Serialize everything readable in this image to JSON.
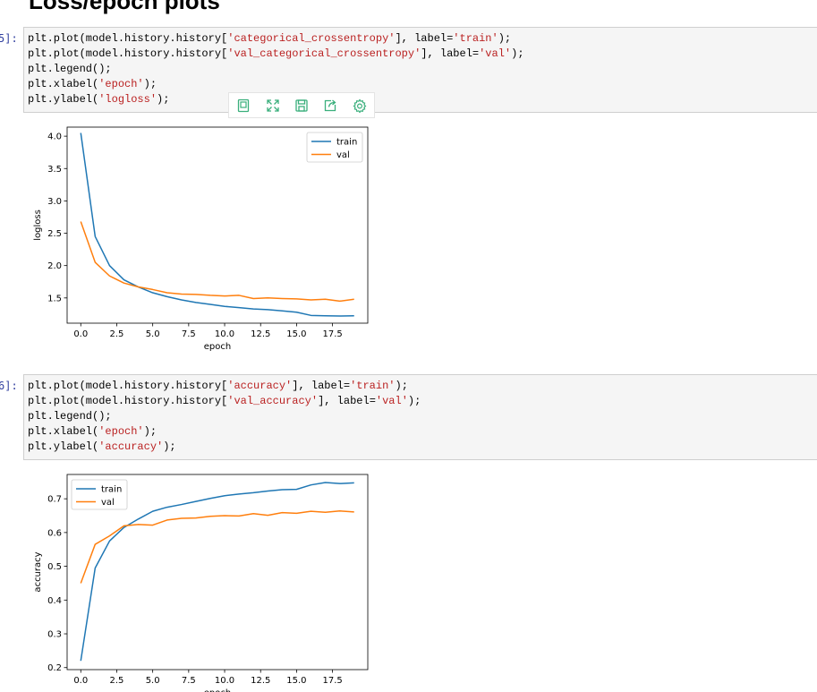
{
  "heading": "Loss/epoch plots",
  "cells": [
    {
      "prompt": "5]:",
      "lines": [
        [
          {
            "t": "plt.plot(model.history.history["
          },
          {
            "t": "'categorical_crossentropy'",
            "s": 1
          },
          {
            "t": "], label="
          },
          {
            "t": "'train'",
            "s": 1
          },
          {
            "t": ");"
          }
        ],
        [
          {
            "t": "plt.plot(model.history.history["
          },
          {
            "t": "'val_categorical_crossentropy'",
            "s": 1
          },
          {
            "t": "], label="
          },
          {
            "t": "'val'",
            "s": 1
          },
          {
            "t": ");"
          }
        ],
        [
          {
            "t": "plt.legend();"
          }
        ],
        [
          {
            "t": "plt.xlabel("
          },
          {
            "t": "'epoch'",
            "s": 1
          },
          {
            "t": ");"
          }
        ],
        [
          {
            "t": "plt.ylabel("
          },
          {
            "t": "'logloss'",
            "s": 1
          },
          {
            "t": ");"
          }
        ]
      ]
    },
    {
      "prompt": "6]:",
      "lines": [
        [
          {
            "t": "plt.plot(model.history.history["
          },
          {
            "t": "'accuracy'",
            "s": 1
          },
          {
            "t": "], label="
          },
          {
            "t": "'train'",
            "s": 1
          },
          {
            "t": ");"
          }
        ],
        [
          {
            "t": "plt.plot(model.history.history["
          },
          {
            "t": "'val_accuracy'",
            "s": 1
          },
          {
            "t": "], label="
          },
          {
            "t": "'val'",
            "s": 1
          },
          {
            "t": ");"
          }
        ],
        [
          {
            "t": "plt.legend();"
          }
        ],
        [
          {
            "t": "plt.xlabel("
          },
          {
            "t": "'epoch'",
            "s": 1
          },
          {
            "t": ");"
          }
        ],
        [
          {
            "t": "plt.ylabel("
          },
          {
            "t": "'accuracy'",
            "s": 1
          },
          {
            "t": ");"
          }
        ]
      ]
    }
  ],
  "toolbar": {
    "accent": "#3aaf7c",
    "icons": [
      "copy-icon",
      "expand-icon",
      "save-icon",
      "share-icon",
      "gear-icon"
    ]
  },
  "colors": {
    "train": "#1f77b4",
    "val": "#ff7f0e"
  },
  "chart_data": [
    {
      "type": "line",
      "title": "",
      "xlabel": "epoch",
      "ylabel": "logloss",
      "xlim": [
        -0.95,
        19.95
      ],
      "ylim": [
        1.11,
        4.14
      ],
      "xticks": [
        0,
        2.5,
        5,
        7.5,
        10,
        12.5,
        15,
        17.5
      ],
      "xtick_labels": [
        "0.0",
        "2.5",
        "5.0",
        "7.5",
        "10.0",
        "12.5",
        "15.0",
        "17.5"
      ],
      "yticks": [
        1.5,
        2,
        2.5,
        3,
        3.5,
        4
      ],
      "ytick_labels": [
        "1.5",
        "2.0",
        "2.5",
        "3.0",
        "3.5",
        "4.0"
      ],
      "legend": "top-right",
      "grid": false,
      "x": [
        0,
        1,
        2,
        3,
        4,
        5,
        6,
        7,
        8,
        9,
        10,
        11,
        12,
        13,
        14,
        15,
        16,
        17,
        18,
        19
      ],
      "series": [
        {
          "name": "train",
          "color": "#1f77b4",
          "values": [
            4.05,
            2.45,
            2.0,
            1.78,
            1.67,
            1.58,
            1.52,
            1.47,
            1.43,
            1.4,
            1.37,
            1.35,
            1.33,
            1.32,
            1.3,
            1.28,
            1.23,
            1.225,
            1.22,
            1.225
          ]
        },
        {
          "name": "val",
          "color": "#ff7f0e",
          "values": [
            2.68,
            2.05,
            1.84,
            1.73,
            1.67,
            1.63,
            1.58,
            1.56,
            1.555,
            1.54,
            1.53,
            1.54,
            1.49,
            1.5,
            1.49,
            1.485,
            1.47,
            1.48,
            1.45,
            1.48
          ]
        }
      ]
    },
    {
      "type": "line",
      "title": "",
      "xlabel": "epoch",
      "ylabel": "accuracy",
      "xlim": [
        -0.95,
        19.95
      ],
      "ylim": [
        0.194,
        0.772
      ],
      "xticks": [
        0,
        2.5,
        5,
        7.5,
        10,
        12.5,
        15,
        17.5
      ],
      "xtick_labels": [
        "0.0",
        "2.5",
        "5.0",
        "7.5",
        "10.0",
        "12.5",
        "15.0",
        "17.5"
      ],
      "yticks": [
        0.2,
        0.3,
        0.4,
        0.5,
        0.6,
        0.7
      ],
      "ytick_labels": [
        "0.2",
        "0.3",
        "0.4",
        "0.5",
        "0.6",
        "0.7"
      ],
      "legend": "top-left",
      "grid": false,
      "x": [
        0,
        1,
        2,
        3,
        4,
        5,
        6,
        7,
        8,
        9,
        10,
        11,
        12,
        13,
        14,
        15,
        16,
        17,
        18,
        19
      ],
      "series": [
        {
          "name": "train",
          "color": "#1f77b4",
          "values": [
            0.22,
            0.495,
            0.575,
            0.615,
            0.64,
            0.663,
            0.675,
            0.683,
            0.692,
            0.701,
            0.709,
            0.714,
            0.718,
            0.723,
            0.727,
            0.728,
            0.741,
            0.748,
            0.745,
            0.747
          ]
        },
        {
          "name": "val",
          "color": "#ff7f0e",
          "values": [
            0.45,
            0.565,
            0.59,
            0.62,
            0.624,
            0.622,
            0.637,
            0.642,
            0.643,
            0.648,
            0.65,
            0.649,
            0.656,
            0.651,
            0.659,
            0.657,
            0.663,
            0.66,
            0.664,
            0.661
          ]
        }
      ]
    }
  ]
}
